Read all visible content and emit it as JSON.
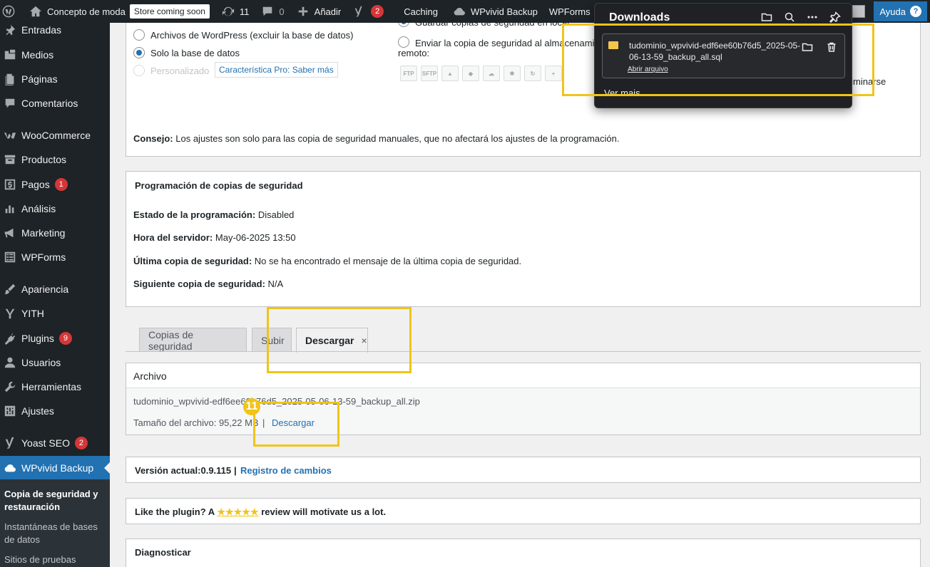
{
  "adminbar": {
    "site_name": "Concepto de moda",
    "store_badge": "Store coming soon",
    "updates_count": "11",
    "comments_count": "0",
    "add_new": "Añadir",
    "yoast_count": "2",
    "caching": "Caching",
    "wpvivid": "WPvivid Backup",
    "wpforms": "WPForms",
    "help": "Ayuda",
    "help_icon": "?"
  },
  "sidebar": {
    "items": [
      {
        "label": "Entradas",
        "icon": "pin-icon"
      },
      {
        "label": "Medios",
        "icon": "media-icon"
      },
      {
        "label": "Páginas",
        "icon": "page-icon"
      },
      {
        "label": "Comentarios",
        "icon": "comment-icon"
      },
      {
        "label": "WooCommerce",
        "icon": "woo-icon"
      },
      {
        "label": "Productos",
        "icon": "archive-icon"
      },
      {
        "label": "Pagos",
        "icon": "dollar-icon",
        "badge": "1"
      },
      {
        "label": "Análisis",
        "icon": "chart-icon"
      },
      {
        "label": "Marketing",
        "icon": "megaphone-icon"
      },
      {
        "label": "WPForms",
        "icon": "forms-icon"
      },
      {
        "label": "Apariencia",
        "icon": "brush-icon"
      },
      {
        "label": "YITH",
        "icon": "yith-icon"
      },
      {
        "label": "Plugins",
        "icon": "plug-icon",
        "badge": "9"
      },
      {
        "label": "Usuarios",
        "icon": "user-icon"
      },
      {
        "label": "Herramientas",
        "icon": "wrench-icon"
      },
      {
        "label": "Ajustes",
        "icon": "settings-icon"
      },
      {
        "label": "Yoast SEO",
        "icon": "yoast-icon",
        "badge": "2"
      },
      {
        "label": "WPvivid Backup",
        "icon": "cloud-icon"
      }
    ],
    "submenu": {
      "current": "Copia de seguridad y restauración",
      "snapshots": "Instantáneas de bases de datos",
      "staging": "Sitios de pruebas"
    }
  },
  "backup_options": {
    "opt_files_db": "Archivos de WordPress (excluir la base de datos)",
    "opt_db_only": "Solo la base de datos",
    "opt_custom": "Personalizado",
    "pro_feature": "Característica Pro: Saber más",
    "save_local": "Guardar copias de seguridad en local",
    "send_remote_line1": "Enviar la copia de seguridad al almacenamiento",
    "send_remote_line2": "remoto:",
    "remote_ftp": "FTP",
    "remote_sftp": "SFTP",
    "partial_right": "eliminarse",
    "tip_label": "Consejo:",
    "tip_text": "Los ajustes son solo para las copia de seguridad manuales, que no afectará los ajustes de la programación."
  },
  "schedule": {
    "title": "Programación de copias de seguridad",
    "status_label": "Estado de la programación:",
    "status_value": "Disabled",
    "server_time_label": "Hora del servidor:",
    "server_time_value": "May-06-2025 13:50",
    "last_label": "Última copia de seguridad:",
    "last_value": "No se ha encontrado el mensaje de la última copia de seguridad.",
    "next_label": "Siguiente copia de seguridad:",
    "next_value": "N/A"
  },
  "tabs": {
    "backups": "Copias de seguridad",
    "upload": "Subir",
    "download": "Descargar",
    "close": "×"
  },
  "download_panel": {
    "header": "Archivo",
    "filename": "tudominio_wpvivid-edf6ee60b76d5_2025-05-06-13-59_backup_all.zip",
    "size_label": "Tamaño del archivo: 95,22 MB",
    "separator": "|",
    "download_link": "Descargar",
    "step": "11"
  },
  "version": {
    "label": "Versión actual:0.9.115",
    "separator": "|",
    "changelog": "Registro de cambios"
  },
  "review": {
    "before": "Like the plugin? A",
    "stars": "★★★★★",
    "after": "review will motivate us a lot."
  },
  "diagnose": {
    "title": "Diagnosticar"
  },
  "downloads_popup": {
    "title": "Downloads",
    "file_name": "tudominio_wpvivid-edf6ee60b76d5_2025-05-06-13-59_backup_all.sql",
    "open_file": "Abrir arquivo",
    "see_more": "Ver mais"
  },
  "colors": {
    "highlight": "#f0c419",
    "wp_blue": "#2271b1",
    "adminbar": "#1d2327"
  }
}
